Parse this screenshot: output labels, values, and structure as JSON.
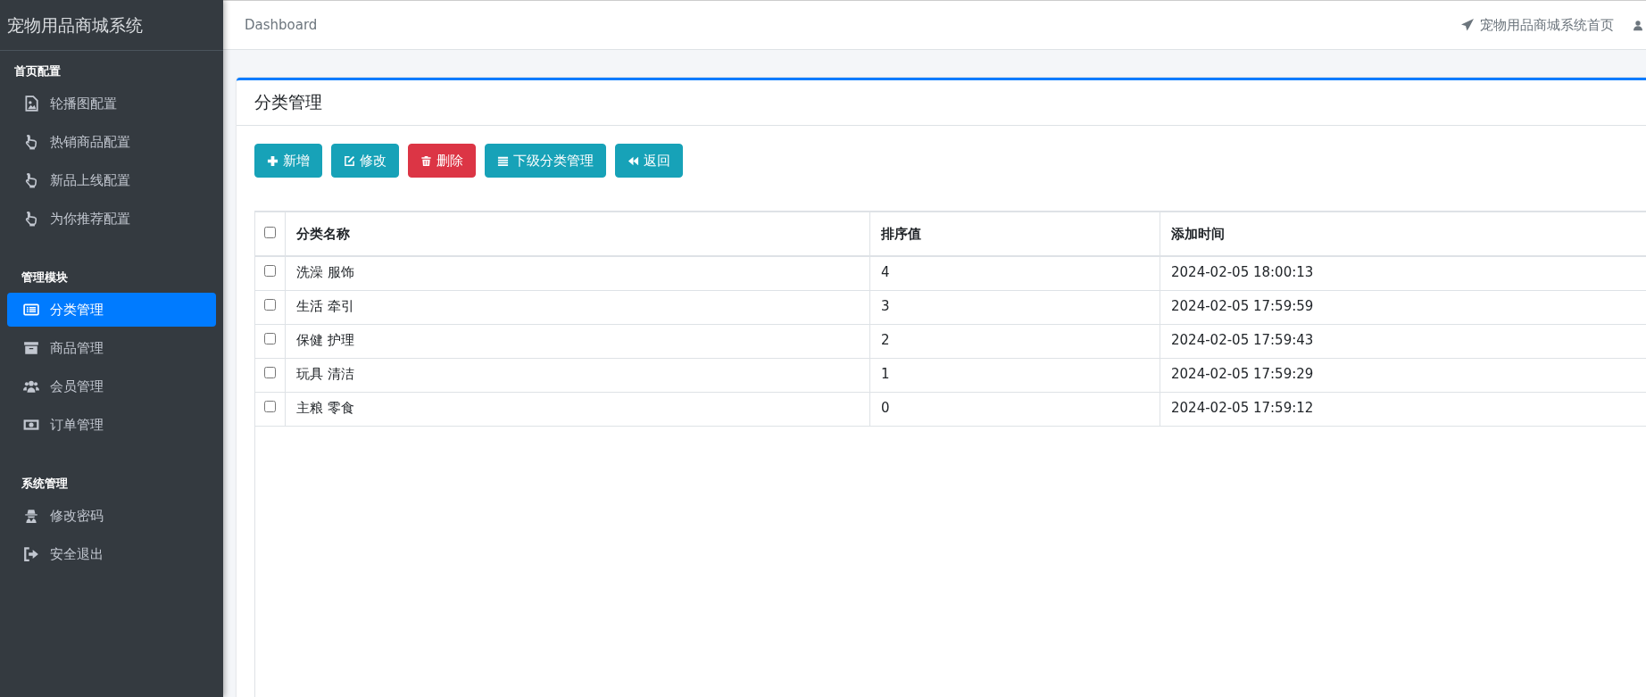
{
  "sidebar": {
    "brand": "宠物用品商城系统",
    "sections": [
      {
        "title": "首页配置",
        "items": [
          {
            "label": "轮播图配置",
            "selected": false
          },
          {
            "label": "热销商品配置",
            "selected": false
          },
          {
            "label": "新品上线配置",
            "selected": false
          },
          {
            "label": "为你推荐配置",
            "selected": false
          }
        ]
      },
      {
        "title": "管理模块",
        "items": [
          {
            "label": "分类管理",
            "selected": true
          },
          {
            "label": "商品管理",
            "selected": false
          },
          {
            "label": "会员管理",
            "selected": false
          },
          {
            "label": "订单管理",
            "selected": false
          }
        ]
      },
      {
        "title": "系统管理",
        "items": [
          {
            "label": "修改密码",
            "selected": false
          },
          {
            "label": "安全退出",
            "selected": false
          }
        ]
      }
    ]
  },
  "topbar": {
    "breadcrumb": "Dashboard",
    "home_link": "宠物用品商城系统首页"
  },
  "card": {
    "title": "分类管理",
    "buttons": [
      {
        "label": "新增",
        "color": "#17a2b8"
      },
      {
        "label": "修改",
        "color": "#17a2b8"
      },
      {
        "label": "删除",
        "color": "#dc3545"
      },
      {
        "label": "下级分类管理",
        "color": "#17a2b8"
      },
      {
        "label": "返回",
        "color": "#17a2b8"
      }
    ],
    "table": {
      "header_checked": false,
      "columns": [
        "分类名称",
        "排序值",
        "添加时间"
      ],
      "rows": [
        {
          "checked": false,
          "cells": [
            "洗澡 服饰",
            "4",
            "2024-02-05 18:00:13"
          ]
        },
        {
          "checked": false,
          "cells": [
            "生活 牵引",
            "3",
            "2024-02-05 17:59:59"
          ]
        },
        {
          "checked": false,
          "cells": [
            "保健 护理",
            "2",
            "2024-02-05 17:59:43"
          ]
        },
        {
          "checked": false,
          "cells": [
            "玩具 清洁",
            "1",
            "2024-02-05 17:59:29"
          ]
        },
        {
          "checked": false,
          "cells": [
            "主粮 零食",
            "0",
            "2024-02-05 17:59:12"
          ]
        }
      ]
    }
  }
}
